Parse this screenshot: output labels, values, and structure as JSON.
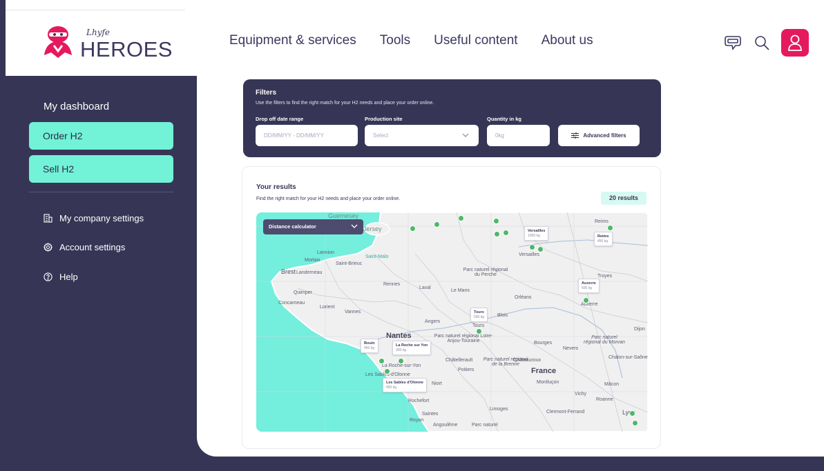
{
  "header": {
    "logo_script": "Lhyfe",
    "logo_word": "HEROES",
    "nav": [
      "Equipment & services",
      "Tools",
      "Useful content",
      "About us"
    ]
  },
  "icons": {
    "chat": "chat-bubbles-icon",
    "search": "search-icon",
    "user": "user-icon"
  },
  "colors": {
    "navy": "#373556",
    "mint": "#72f2d6",
    "brand_pink": "#e5195e",
    "map_sea": "#74eedd",
    "map_land": "#f0f0f0",
    "dot_green": "#4cb86a"
  },
  "sidebar": {
    "title": "My dashboard",
    "buttons": [
      "Order H2",
      "Sell H2"
    ],
    "links": [
      "My company settings",
      "Account settings",
      "Help"
    ]
  },
  "filters": {
    "title": "Filters",
    "subtitle": "Use the filters to find the right match for your H2 needs and place your order online.",
    "date_label": "Drop off date range",
    "date_placeholder": "DD/MM/YY - DD/MM/YY",
    "site_label": "Production site",
    "site_placeholder": "Select",
    "qty_label": "Quantity in kg",
    "qty_placeholder": "0kg",
    "advanced": "Advanced filters"
  },
  "results": {
    "title": "Your results",
    "subtitle": "Find the right match for your H2 needs and place your order online.",
    "count": "20 results",
    "distance_calculator": "Distance calculator"
  },
  "map": {
    "island_labels": [
      "Guernesey",
      "Jersey"
    ],
    "towns": [
      "Lannion",
      "Morlaix",
      "Saint-Brieuc",
      "Saint-Malo",
      "Brest",
      "Landerneau",
      "Quimper",
      "Concarneau",
      "Lorient",
      "Vannes",
      "Rennes",
      "Laval",
      "Le Mans",
      "Angers",
      "Nantes",
      "Tours",
      "Blois",
      "Orléans",
      "Bourges",
      "Nevers",
      "Châtellerault",
      "Châteauroux",
      "Poitiers",
      "La Roche-sur-Yon",
      "Les Sables-d'Olonne",
      "Niort",
      "Rochefort",
      "Saintes",
      "Royan",
      "Angoulême",
      "Limoges",
      "Montluçon",
      "Vichy",
      "Roanne",
      "Clermont-Ferrand",
      "Mâcon",
      "Chalon-sur-Saône",
      "Dijon",
      "Troyes",
      "Reims",
      "Auxerre",
      "Versailles",
      "Lyon"
    ],
    "regions": [
      "Parc naturel régional du Perche",
      "Parc naturel régional Loire-Anjou-Touraine",
      "Parc naturel régional de la Brenne",
      "Parc naturel régional du Morvan",
      "Parc naturel"
    ],
    "country": "France",
    "sites": [
      {
        "name": "Versailles",
        "qty": "1000 kg"
      },
      {
        "name": "Reims",
        "qty": "450 kg"
      },
      {
        "name": "Auxerre",
        "qty": "500 kg"
      },
      {
        "name": "Tours",
        "qty": "500 kg"
      },
      {
        "name": "Bouin",
        "qty": "450 kg"
      },
      {
        "name": "La Roche sur Yon",
        "qty": "350 kg"
      },
      {
        "name": "Les Sables d'Olonne",
        "qty": "450 kg"
      }
    ]
  }
}
